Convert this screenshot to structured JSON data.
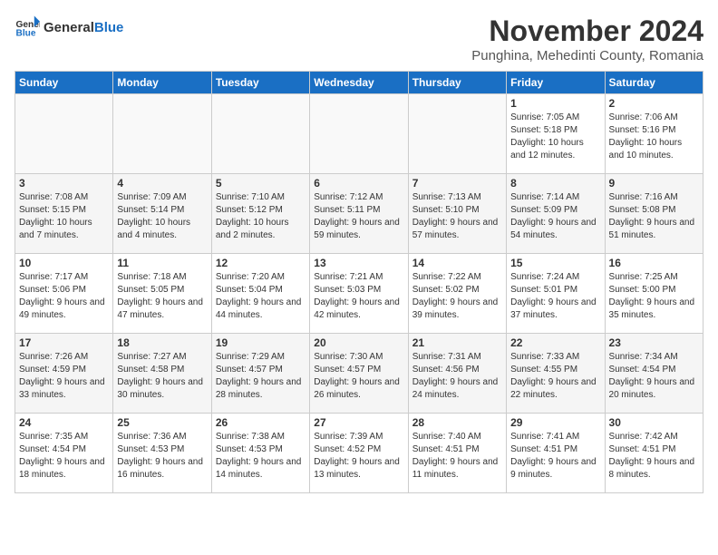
{
  "header": {
    "logo_general": "General",
    "logo_blue": "Blue",
    "month_title": "November 2024",
    "location": "Punghina, Mehedinti County, Romania"
  },
  "weekdays": [
    "Sunday",
    "Monday",
    "Tuesday",
    "Wednesday",
    "Thursday",
    "Friday",
    "Saturday"
  ],
  "weeks": [
    [
      {
        "day": "",
        "info": ""
      },
      {
        "day": "",
        "info": ""
      },
      {
        "day": "",
        "info": ""
      },
      {
        "day": "",
        "info": ""
      },
      {
        "day": "",
        "info": ""
      },
      {
        "day": "1",
        "info": "Sunrise: 7:05 AM\nSunset: 5:18 PM\nDaylight: 10 hours and 12 minutes."
      },
      {
        "day": "2",
        "info": "Sunrise: 7:06 AM\nSunset: 5:16 PM\nDaylight: 10 hours and 10 minutes."
      }
    ],
    [
      {
        "day": "3",
        "info": "Sunrise: 7:08 AM\nSunset: 5:15 PM\nDaylight: 10 hours and 7 minutes."
      },
      {
        "day": "4",
        "info": "Sunrise: 7:09 AM\nSunset: 5:14 PM\nDaylight: 10 hours and 4 minutes."
      },
      {
        "day": "5",
        "info": "Sunrise: 7:10 AM\nSunset: 5:12 PM\nDaylight: 10 hours and 2 minutes."
      },
      {
        "day": "6",
        "info": "Sunrise: 7:12 AM\nSunset: 5:11 PM\nDaylight: 9 hours and 59 minutes."
      },
      {
        "day": "7",
        "info": "Sunrise: 7:13 AM\nSunset: 5:10 PM\nDaylight: 9 hours and 57 minutes."
      },
      {
        "day": "8",
        "info": "Sunrise: 7:14 AM\nSunset: 5:09 PM\nDaylight: 9 hours and 54 minutes."
      },
      {
        "day": "9",
        "info": "Sunrise: 7:16 AM\nSunset: 5:08 PM\nDaylight: 9 hours and 51 minutes."
      }
    ],
    [
      {
        "day": "10",
        "info": "Sunrise: 7:17 AM\nSunset: 5:06 PM\nDaylight: 9 hours and 49 minutes."
      },
      {
        "day": "11",
        "info": "Sunrise: 7:18 AM\nSunset: 5:05 PM\nDaylight: 9 hours and 47 minutes."
      },
      {
        "day": "12",
        "info": "Sunrise: 7:20 AM\nSunset: 5:04 PM\nDaylight: 9 hours and 44 minutes."
      },
      {
        "day": "13",
        "info": "Sunrise: 7:21 AM\nSunset: 5:03 PM\nDaylight: 9 hours and 42 minutes."
      },
      {
        "day": "14",
        "info": "Sunrise: 7:22 AM\nSunset: 5:02 PM\nDaylight: 9 hours and 39 minutes."
      },
      {
        "day": "15",
        "info": "Sunrise: 7:24 AM\nSunset: 5:01 PM\nDaylight: 9 hours and 37 minutes."
      },
      {
        "day": "16",
        "info": "Sunrise: 7:25 AM\nSunset: 5:00 PM\nDaylight: 9 hours and 35 minutes."
      }
    ],
    [
      {
        "day": "17",
        "info": "Sunrise: 7:26 AM\nSunset: 4:59 PM\nDaylight: 9 hours and 33 minutes."
      },
      {
        "day": "18",
        "info": "Sunrise: 7:27 AM\nSunset: 4:58 PM\nDaylight: 9 hours and 30 minutes."
      },
      {
        "day": "19",
        "info": "Sunrise: 7:29 AM\nSunset: 4:57 PM\nDaylight: 9 hours and 28 minutes."
      },
      {
        "day": "20",
        "info": "Sunrise: 7:30 AM\nSunset: 4:57 PM\nDaylight: 9 hours and 26 minutes."
      },
      {
        "day": "21",
        "info": "Sunrise: 7:31 AM\nSunset: 4:56 PM\nDaylight: 9 hours and 24 minutes."
      },
      {
        "day": "22",
        "info": "Sunrise: 7:33 AM\nSunset: 4:55 PM\nDaylight: 9 hours and 22 minutes."
      },
      {
        "day": "23",
        "info": "Sunrise: 7:34 AM\nSunset: 4:54 PM\nDaylight: 9 hours and 20 minutes."
      }
    ],
    [
      {
        "day": "24",
        "info": "Sunrise: 7:35 AM\nSunset: 4:54 PM\nDaylight: 9 hours and 18 minutes."
      },
      {
        "day": "25",
        "info": "Sunrise: 7:36 AM\nSunset: 4:53 PM\nDaylight: 9 hours and 16 minutes."
      },
      {
        "day": "26",
        "info": "Sunrise: 7:38 AM\nSunset: 4:53 PM\nDaylight: 9 hours and 14 minutes."
      },
      {
        "day": "27",
        "info": "Sunrise: 7:39 AM\nSunset: 4:52 PM\nDaylight: 9 hours and 13 minutes."
      },
      {
        "day": "28",
        "info": "Sunrise: 7:40 AM\nSunset: 4:51 PM\nDaylight: 9 hours and 11 minutes."
      },
      {
        "day": "29",
        "info": "Sunrise: 7:41 AM\nSunset: 4:51 PM\nDaylight: 9 hours and 9 minutes."
      },
      {
        "day": "30",
        "info": "Sunrise: 7:42 AM\nSunset: 4:51 PM\nDaylight: 9 hours and 8 minutes."
      }
    ]
  ]
}
